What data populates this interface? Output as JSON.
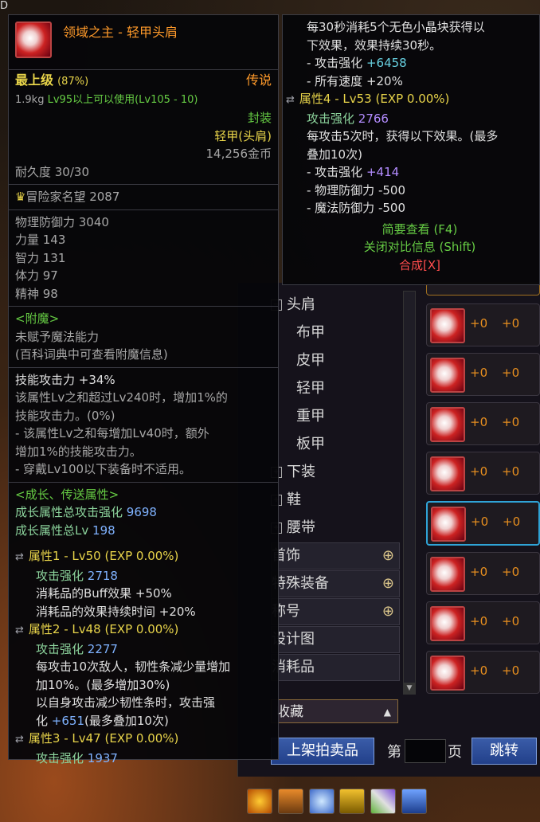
{
  "corner_text": "D",
  "tooltip_left": {
    "item_name": "领域之主 - 轻甲头肩",
    "grade": "最上级",
    "grade_pct": "(87%)",
    "rarity": "传说",
    "weight": "1.9kg",
    "level_req": "Lv95以上可以使用(Lv105 - 10)",
    "seal": "封装",
    "type": "轻甲(头肩)",
    "price": "14,256金币",
    "durability": "耐久度 30/30",
    "reputation": "冒险家名望 2087",
    "stats": [
      "物理防御力 3040",
      "力量 143",
      "智力 131",
      "体力 97",
      "精神 98"
    ],
    "enchant_title": "<附魔>",
    "enchant_lines": [
      "未赋予魔法能力",
      "(百科词典中可查看附魔信息)"
    ],
    "skill_title": "技能攻击力 +34%",
    "skill_lines": [
      "该属性Lv之和超过Lv240时，增加1%的",
      "技能攻击力。(0%)",
      "- 该属性Lv之和每增加Lv40时，额外",
      "增加1%的技能攻击力。",
      "- 穿戴Lv100以下装备时不适用。"
    ],
    "growth_title": "<成长、传送属性>",
    "growth_atk_label": "成长属性总攻击强化",
    "growth_atk": "9698",
    "growth_lv_label": "成长属性总Lv",
    "growth_lv": "198",
    "attr1": {
      "title": "属性1 - Lv50 (EXP 0.00%)",
      "atk_label": "攻击强化",
      "atk": "2718",
      "lines": [
        "消耗品的Buff效果 +50%",
        "消耗品的效果持续时间 +20%"
      ]
    },
    "attr2": {
      "title": "属性2 - Lv48 (EXP 0.00%)",
      "atk_label": "攻击强化",
      "atk": "2277",
      "lines": [
        "每攻击10次敌人，韧性条减少量增加",
        "加10%。(最多增加30%)",
        "以自身攻击减少韧性条时，攻击强"
      ],
      "last_pre": "化",
      "last_val": "+651",
      "last_post": "(最多叠加10次)"
    },
    "attr3": {
      "title": "属性3 - Lv47 (EXP 0.00%)",
      "atk_label": "攻击强化",
      "atk": "1937"
    }
  },
  "tooltip_right": {
    "lines_top": [
      "每30秒消耗5个无色小晶块获得以",
      "下效果，效果持续30秒。"
    ],
    "atk_label": "- 攻击强化",
    "atk_val": "+6458",
    "speed": "- 所有速度 +20%",
    "attr4_title": "属性4 - Lv53 (EXP 0.00%)",
    "attr4_atk_label": "攻击强化",
    "attr4_atk": "2766",
    "hit_lines": [
      "每攻击5次时，获得以下效果。(最多",
      "叠加10次)"
    ],
    "atk2_label": "- 攻击强化",
    "atk2_val": "+414",
    "pdef": "- 物理防御力 -500",
    "mdef": "- 魔法防御力 -500",
    "summary": "简要查看 (F4)",
    "close_compare": "关闭对比信息 (Shift)",
    "synth": "合成[X]"
  },
  "categories": {
    "shoulder": "头肩",
    "cloth": "布甲",
    "leather": "皮甲",
    "light": "轻甲",
    "heavy": "重甲",
    "plate": "板甲",
    "pants": "下装",
    "shoes": "鞋",
    "belt": "腰带",
    "accessory": "首饰",
    "special": "特殊装备",
    "title": "称号",
    "design": "设计图",
    "consumable": "消耗品",
    "favorites": "收藏"
  },
  "item_list": [
    {
      "a": "+0",
      "b": "+0"
    },
    {
      "a": "+0",
      "b": "+0"
    },
    {
      "a": "+0",
      "b": "+0"
    },
    {
      "a": "+0",
      "b": "+0"
    },
    {
      "a": "+0",
      "b": "+0"
    },
    {
      "a": "+0",
      "b": "+0"
    },
    {
      "a": "+0",
      "b": "+0"
    },
    {
      "a": "+0",
      "b": "+0"
    }
  ],
  "bottom": {
    "shelf_btn": "上架拍卖品",
    "page_prefix": "第",
    "page_suffix": "页",
    "jump_btn": "跳转"
  },
  "colors": {
    "accent_orange": "#ff9a2a",
    "legend_orange": "#ff9a2a",
    "green": "#66cc44",
    "blue_value": "#7fb2ff",
    "purple_value": "#b38cff",
    "red": "#ff4d4d",
    "select_border": "#2fa3d6"
  }
}
